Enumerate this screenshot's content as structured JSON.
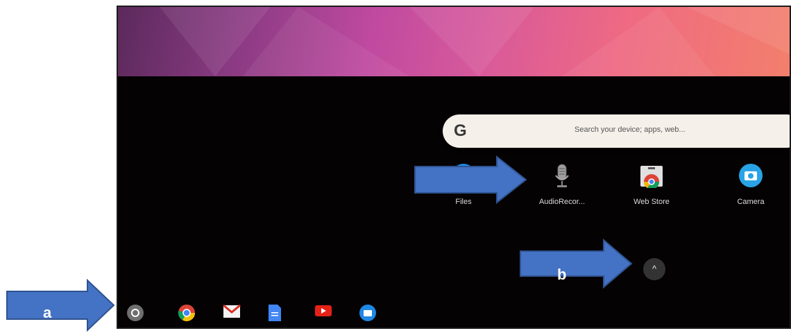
{
  "search": {
    "logo": "G",
    "placeholder": "Search your device; apps, web..."
  },
  "apps": [
    {
      "label": "Files",
      "icon": "files-icon"
    },
    {
      "label": "AudioRecor...",
      "icon": "microphone-icon"
    },
    {
      "label": "Web Store",
      "icon": "web-store-icon"
    },
    {
      "label": "Camera",
      "icon": "camera-icon"
    }
  ],
  "expand_button": {
    "icon": "chevron-up-icon",
    "glyph": "^"
  },
  "shelf": [
    {
      "icon": "launcher-icon"
    },
    {
      "icon": "chrome-icon"
    },
    {
      "icon": "gmail-icon"
    },
    {
      "icon": "docs-icon"
    },
    {
      "icon": "youtube-icon"
    },
    {
      "icon": "files-icon"
    }
  ],
  "annotations": {
    "arrow_a_label": "a",
    "arrow_b_label": "b"
  },
  "colors": {
    "arrow_fill": "#4472c4",
    "arrow_stroke": "#2f528f",
    "search_bg": "#f6f0ea"
  }
}
